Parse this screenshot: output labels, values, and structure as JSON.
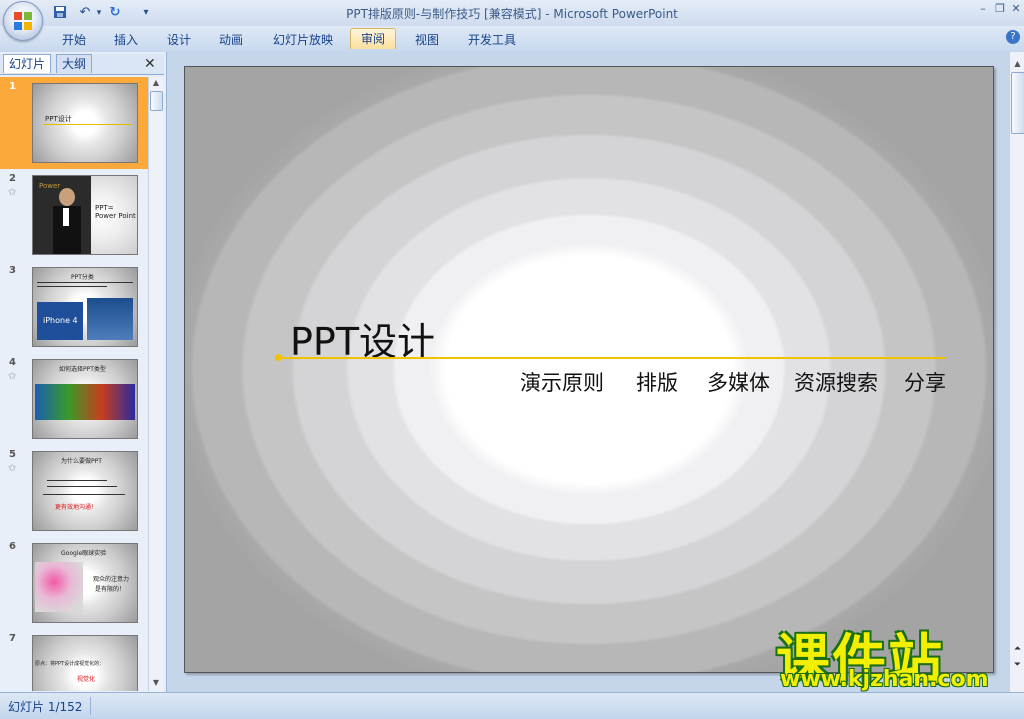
{
  "window": {
    "title": "PPT排版原则-与制作技巧 [兼容模式] - Microsoft PowerPoint",
    "min_glyph": "–",
    "restore_glyph": "❐",
    "close_glyph": "✕"
  },
  "quick_access": {
    "save_icon": "save-icon",
    "undo_icon": "undo-icon",
    "redo_icon": "redo-icon",
    "customize_glyph": "▾"
  },
  "ribbon": {
    "tabs": [
      "开始",
      "插入",
      "设计",
      "动画",
      "幻灯片放映",
      "审阅",
      "视图",
      "开发工具"
    ],
    "active_tab": "审阅",
    "help_glyph": "?"
  },
  "left_panel": {
    "tab_slides": "幻灯片",
    "tab_outline": "大纲",
    "close_glyph": "✕",
    "thumbnails": [
      {
        "number": "1",
        "title": "PPT设计",
        "selected": true
      },
      {
        "number": "2",
        "title": "PPT=\nPower Point",
        "caption": "Power",
        "star": true
      },
      {
        "number": "3",
        "title": "PPT分类",
        "caption": "iPhone 4"
      },
      {
        "number": "4",
        "title": "如何选择PPT类型",
        "star": true
      },
      {
        "number": "5",
        "title": "为什么要做PPT",
        "line1": "更有效地沟通！",
        "star": true
      },
      {
        "number": "6",
        "title": "Google眼球实验",
        "line1": "观众的注意力",
        "line2": "是有限的！"
      },
      {
        "number": "7",
        "title": "原点：将PPT设计成视觉化的：",
        "line1": "视觉化"
      }
    ]
  },
  "slide": {
    "title": "PPT设计",
    "subtitles": [
      "演示原则",
      "排版",
      "多媒体",
      "资源搜索",
      "分享"
    ]
  },
  "status": {
    "slide_counter": "幻灯片 1/152"
  },
  "watermark": {
    "big": "课件站",
    "url": "www.kjzhan.com"
  },
  "colors": {
    "accent_line": "#f2c200",
    "selected_thumb": "#fba93b",
    "watermark_fill": "#f2ef00",
    "watermark_stroke": "#1a6f16"
  }
}
